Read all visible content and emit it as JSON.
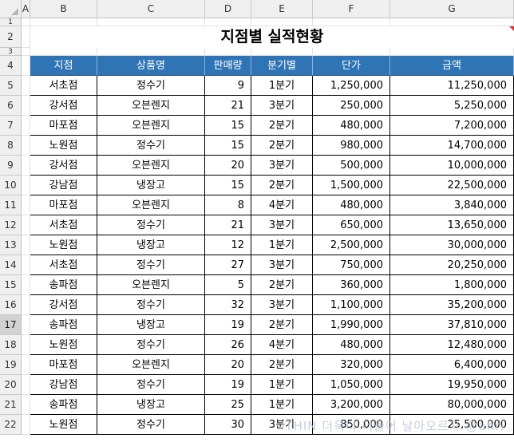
{
  "columns": [
    "A",
    "B",
    "C",
    "D",
    "E",
    "F",
    "G"
  ],
  "rows": [
    "1",
    "2",
    "3",
    "4",
    "5",
    "6",
    "7",
    "8",
    "9",
    "10",
    "11",
    "12",
    "13",
    "14",
    "15",
    "16",
    "17",
    "18",
    "19",
    "20",
    "21",
    "22"
  ],
  "selected_row": "17",
  "title": "지점별 실적현황",
  "table": {
    "headers": [
      "지점",
      "상품명",
      "판매량",
      "분기별",
      "단가",
      "금액"
    ],
    "rows": [
      [
        "서초점",
        "정수기",
        "9",
        "1분기",
        "1,250,000",
        "11,250,000"
      ],
      [
        "강서점",
        "오븐렌지",
        "21",
        "3분기",
        "250,000",
        "5,250,000"
      ],
      [
        "마포점",
        "오븐렌지",
        "15",
        "2분기",
        "480,000",
        "7,200,000"
      ],
      [
        "노원점",
        "정수기",
        "15",
        "2분기",
        "980,000",
        "14,700,000"
      ],
      [
        "강서점",
        "오븐렌지",
        "20",
        "3분기",
        "500,000",
        "10,000,000"
      ],
      [
        "강남점",
        "냉장고",
        "15",
        "2분기",
        "1,500,000",
        "22,500,000"
      ],
      [
        "마포점",
        "오븐렌지",
        "8",
        "4분기",
        "480,000",
        "3,840,000"
      ],
      [
        "서초점",
        "정수기",
        "21",
        "3분기",
        "650,000",
        "13,650,000"
      ],
      [
        "노원점",
        "냉장고",
        "12",
        "1분기",
        "2,500,000",
        "30,000,000"
      ],
      [
        "서초점",
        "정수기",
        "27",
        "3분기",
        "750,000",
        "20,250,000"
      ],
      [
        "송파점",
        "오븐렌지",
        "5",
        "2분기",
        "360,000",
        "1,800,000"
      ],
      [
        "강서점",
        "정수기",
        "32",
        "3분기",
        "1,100,000",
        "35,200,000"
      ],
      [
        "송파점",
        "냉장고",
        "19",
        "2분기",
        "1,990,000",
        "37,810,000"
      ],
      [
        "노원점",
        "정수기",
        "26",
        "4분기",
        "480,000",
        "12,480,000"
      ],
      [
        "마포점",
        "오븐렌지",
        "20",
        "2분기",
        "320,000",
        "6,400,000"
      ],
      [
        "강남점",
        "정수기",
        "19",
        "1분기",
        "1,050,000",
        "19,950,000"
      ],
      [
        "송파점",
        "냉장고",
        "25",
        "1분기",
        "3,200,000",
        "80,000,000"
      ],
      [
        "노원점",
        "정수기",
        "30",
        "3분기",
        "850,000",
        "25,500,000"
      ]
    ]
  },
  "watermark": "ITHIN 더욱더 더들어 날아오르자 @ahri",
  "colors": {
    "header_fill": "#2f75b5",
    "header_text": "#ffffff",
    "comment_marker": "#e03030"
  }
}
